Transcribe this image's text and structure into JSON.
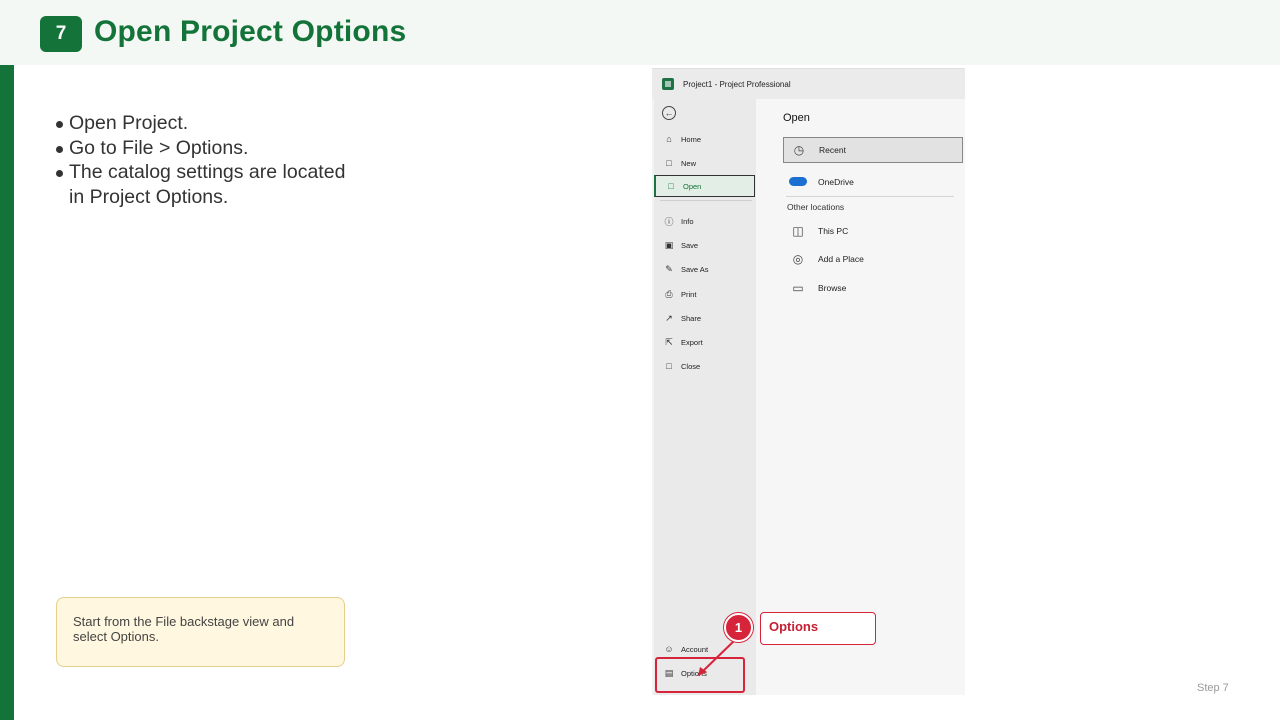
{
  "header": {
    "step_number": "7",
    "title": "Open Project Options"
  },
  "bullets": [
    "Open Project.",
    "Go to File > Options.",
    "The catalog settings are located in Project Options."
  ],
  "note": "Start from the File backstage view and select Options.",
  "footer": {
    "step_label": "Step 7"
  },
  "screenshot": {
    "window_title": "Project1  -  Project Professional",
    "nav_items": [
      {
        "label": "Home",
        "icon": "home-icon"
      },
      {
        "label": "New",
        "icon": "new-file-icon"
      },
      {
        "label": "Open",
        "icon": "folder-open-icon",
        "selected": true
      },
      {
        "label": "Info",
        "icon": "info-icon"
      },
      {
        "label": "Save",
        "icon": "save-icon"
      },
      {
        "label": "Save As",
        "icon": "save-as-icon"
      },
      {
        "label": "Print",
        "icon": "print-icon"
      },
      {
        "label": "Share",
        "icon": "share-icon"
      },
      {
        "label": "Export",
        "icon": "export-icon"
      },
      {
        "label": "Close",
        "icon": "folder-close-icon"
      },
      {
        "label": "Account",
        "icon": "account-icon"
      },
      {
        "label": "Options",
        "icon": "options-icon"
      }
    ],
    "open_heading": "Open",
    "locations": [
      {
        "label": "Recent",
        "icon": "clock-icon",
        "selected": true
      },
      {
        "label": "OneDrive",
        "icon": "onedrive-icon"
      }
    ],
    "other_locations_heading": "Other locations",
    "other_locations": [
      {
        "label": "This PC",
        "icon": "computer-icon"
      },
      {
        "label": "Add a Place",
        "icon": "globe-icon"
      },
      {
        "label": "Browse",
        "icon": "folder-icon"
      }
    ]
  },
  "callout": {
    "number": "1",
    "label": "Options"
  },
  "colors": {
    "brand_green": "#137339",
    "callout_red": "#d6243a",
    "note_bg": "#fff7df"
  }
}
